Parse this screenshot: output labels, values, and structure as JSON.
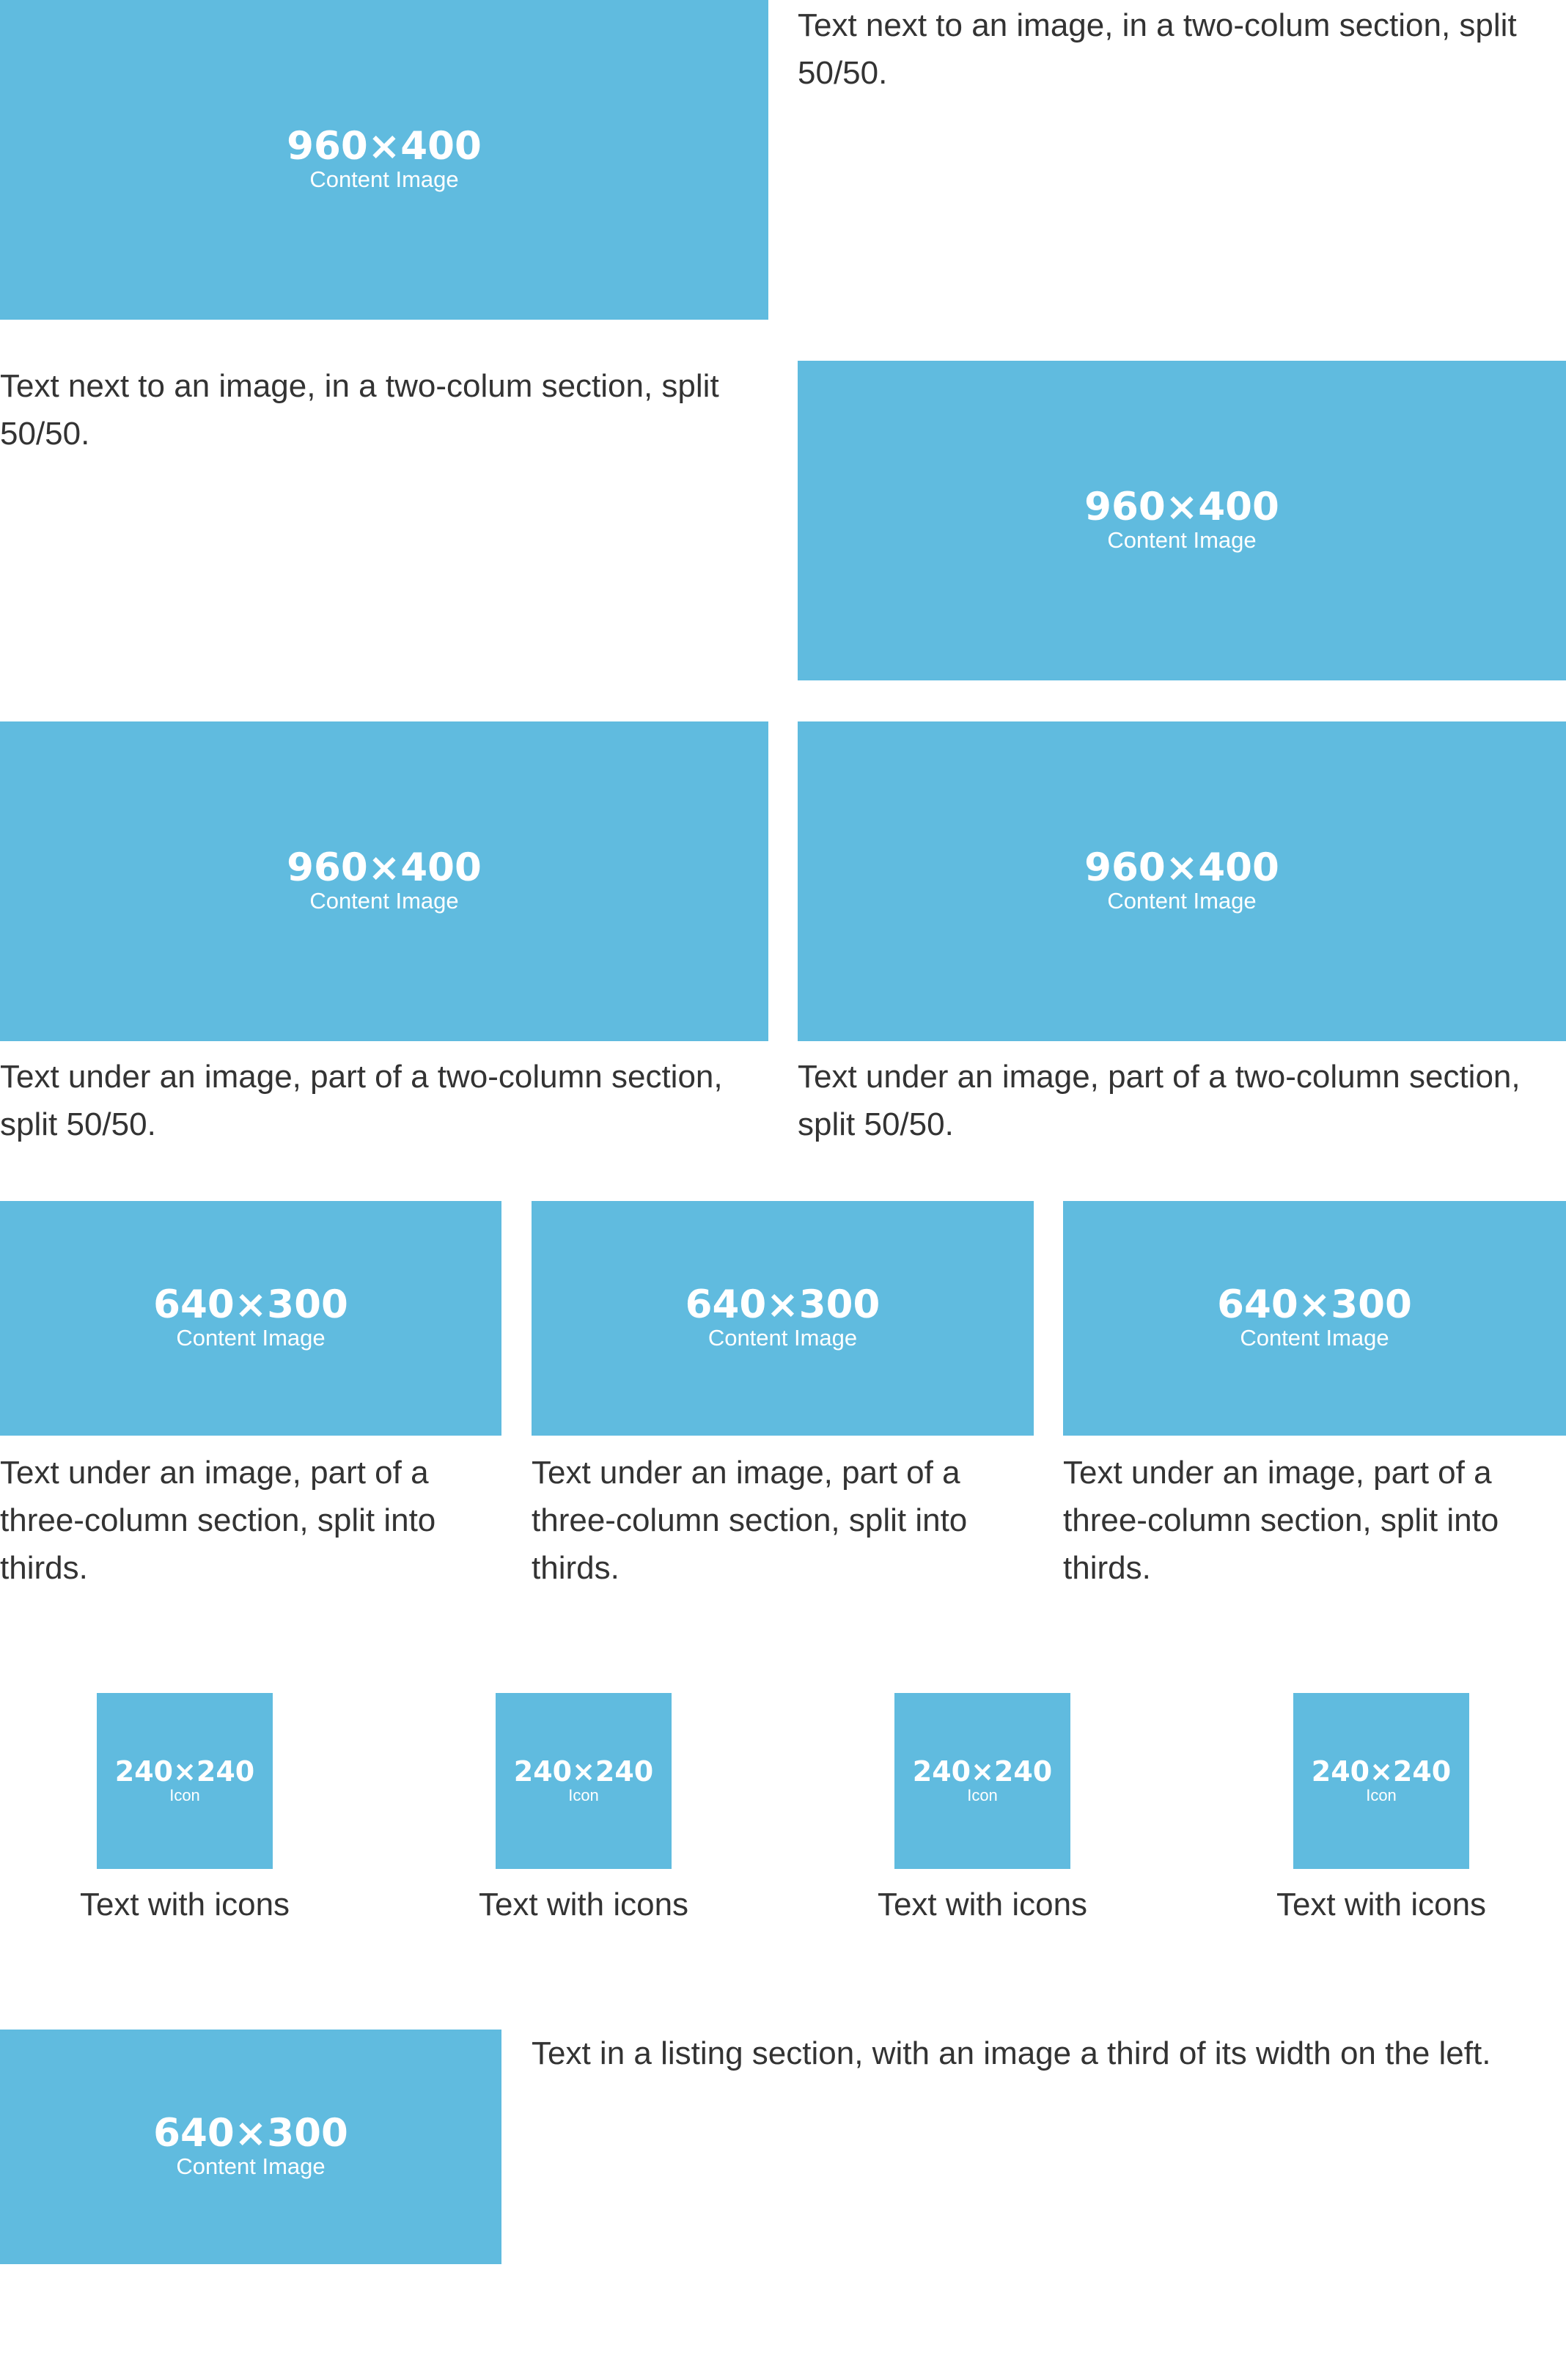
{
  "colors": {
    "placeholder_bg": "#60bbdf",
    "placeholder_text": "#ffffff",
    "body_text": "#333333",
    "page_bg": "#ffffff"
  },
  "row1": {
    "image": {
      "dimensions": "960×400",
      "label": "Content Image"
    },
    "text": "Text next to an image, in a two-colum section, split 50/50."
  },
  "row2": {
    "text": "Text next to an image, in a two-colum section, split 50/50.",
    "image": {
      "dimensions": "960×400",
      "label": "Content Image"
    }
  },
  "row3": {
    "columns": [
      {
        "image": {
          "dimensions": "960×400",
          "label": "Content Image"
        },
        "text": "Text under an image, part of a two-column section, split 50/50."
      },
      {
        "image": {
          "dimensions": "960×400",
          "label": "Content Image"
        },
        "text": "Text under an image, part of a two-column section, split 50/50."
      }
    ]
  },
  "row4": {
    "columns": [
      {
        "image": {
          "dimensions": "640×300",
          "label": "Content Image"
        },
        "text": "Text under an image, part of a three-column section, split into thirds."
      },
      {
        "image": {
          "dimensions": "640×300",
          "label": "Content Image"
        },
        "text": "Text under an image, part of a three-column section, split into thirds."
      },
      {
        "image": {
          "dimensions": "640×300",
          "label": "Content Image"
        },
        "text": "Text under an image, part of a three-column section, split into thirds."
      }
    ]
  },
  "row5": {
    "icons": [
      {
        "dimensions": "240×240",
        "label": "Icon",
        "text": "Text with icons"
      },
      {
        "dimensions": "240×240",
        "label": "Icon",
        "text": "Text with icons"
      },
      {
        "dimensions": "240×240",
        "label": "Icon",
        "text": "Text with icons"
      },
      {
        "dimensions": "240×240",
        "label": "Icon",
        "text": "Text with icons"
      }
    ]
  },
  "row6": {
    "image": {
      "dimensions": "640×300",
      "label": "Content Image"
    },
    "text": "Text in a listing section, with an image a third of its width on the left."
  }
}
